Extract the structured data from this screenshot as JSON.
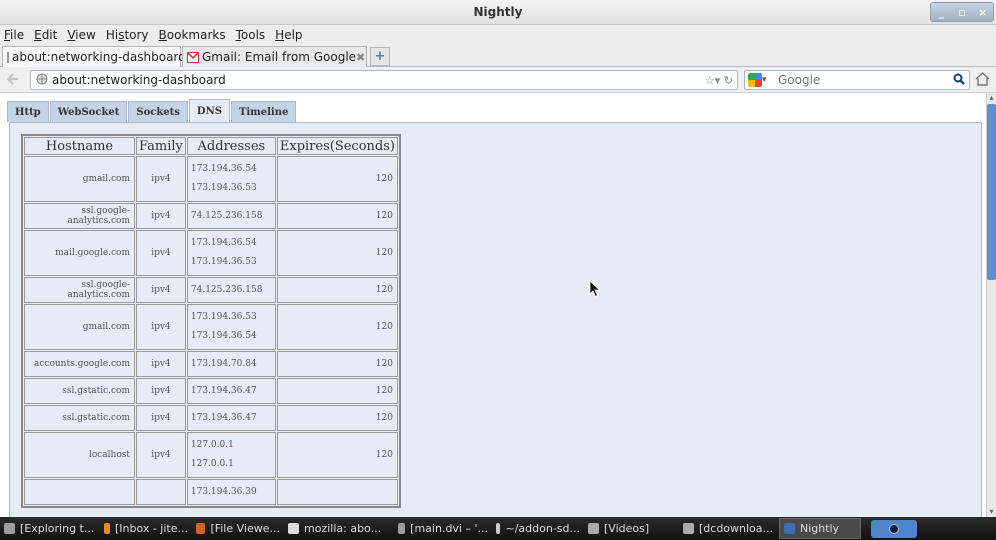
{
  "window": {
    "title": "Nightly",
    "buttons": [
      "_",
      "▫",
      "×"
    ]
  },
  "menubar": [
    {
      "label": "File",
      "u": "F"
    },
    {
      "label": "Edit",
      "u": "E"
    },
    {
      "label": "View",
      "u": "V"
    },
    {
      "label": "History",
      "u": "s"
    },
    {
      "label": "Bookmarks",
      "u": "B"
    },
    {
      "label": "Tools",
      "u": "T"
    },
    {
      "label": "Help",
      "u": "H"
    }
  ],
  "tabs": [
    {
      "label": "about:networking-dashboard",
      "active": true,
      "close": "✖"
    },
    {
      "label": "Gmail: Email from Google",
      "active": false,
      "close": "✖"
    }
  ],
  "newtab_label": "+",
  "nav": {
    "url": "about:networking-dashboard",
    "search_placeholder": "Google"
  },
  "dashboard_tabs": [
    "Http",
    "WebSocket",
    "Sockets",
    "DNS",
    "Timeline"
  ],
  "active_dashboard_tab": "DNS",
  "dns_table": {
    "headers": [
      "Hostname",
      "Family",
      "Addresses",
      "Expires(Seconds)"
    ],
    "rows": [
      {
        "host": "gmail.com",
        "family": "ipv4",
        "addresses": [
          "173.194.36.54",
          "173.194.36.53"
        ],
        "expires": "120"
      },
      {
        "host": "ssl.google-analytics.com",
        "family": "ipv4",
        "addresses": [
          "74.125.236.158"
        ],
        "expires": "120"
      },
      {
        "host": "mail.google.com",
        "family": "ipv4",
        "addresses": [
          "173.194.36.54",
          "173.194.36.53"
        ],
        "expires": "120"
      },
      {
        "host": "ssl.google-analytics.com",
        "family": "ipv4",
        "addresses": [
          "74.125.236.158"
        ],
        "expires": "120"
      },
      {
        "host": "gmail.com",
        "family": "ipv4",
        "addresses": [
          "173.194.36.53",
          "173.194.36.54"
        ],
        "expires": "120"
      },
      {
        "host": "accounts.google.com",
        "family": "ipv4",
        "addresses": [
          "173.194.70.84"
        ],
        "expires": "120"
      },
      {
        "host": "ssl.gstatic.com",
        "family": "ipv4",
        "addresses": [
          "173.194.36.47"
        ],
        "expires": "120"
      },
      {
        "host": "ssl.gstatic.com",
        "family": "ipv4",
        "addresses": [
          "173.194.36.47"
        ],
        "expires": "120"
      },
      {
        "host": "localhost",
        "family": "ipv4",
        "addresses": [
          "127.0.0.1",
          "127.0.0.1"
        ],
        "expires": "120"
      },
      {
        "host": "",
        "family": "",
        "addresses": [
          "173.194.36.39"
        ],
        "expires": ""
      }
    ]
  },
  "taskbar": [
    {
      "label": "[Exploring t...",
      "icon": "#9c9c9c",
      "width": 100
    },
    {
      "label": "[Inbox - jite...",
      "icon": "#e08a2c",
      "width": 92
    },
    {
      "label": "[File Viewe...",
      "icon": "#d0622c",
      "width": 92
    },
    {
      "label": "mozilla: abo...",
      "icon": "#dddddd",
      "width": 110
    },
    {
      "label": "[main.dvi – '...",
      "icon": "#9c9c9c",
      "width": 98
    },
    {
      "label": "~/addon-sd...",
      "icon": "#cccccc",
      "width": 92
    },
    {
      "label": "[Videos]",
      "icon": "#aaaaaa",
      "width": 95
    },
    {
      "label": "[dcdownloa...",
      "icon": "#aaaaaa",
      "width": 100
    },
    {
      "label": "Nightly",
      "icon": "#3c6fb0",
      "width": 82,
      "active": true
    }
  ]
}
